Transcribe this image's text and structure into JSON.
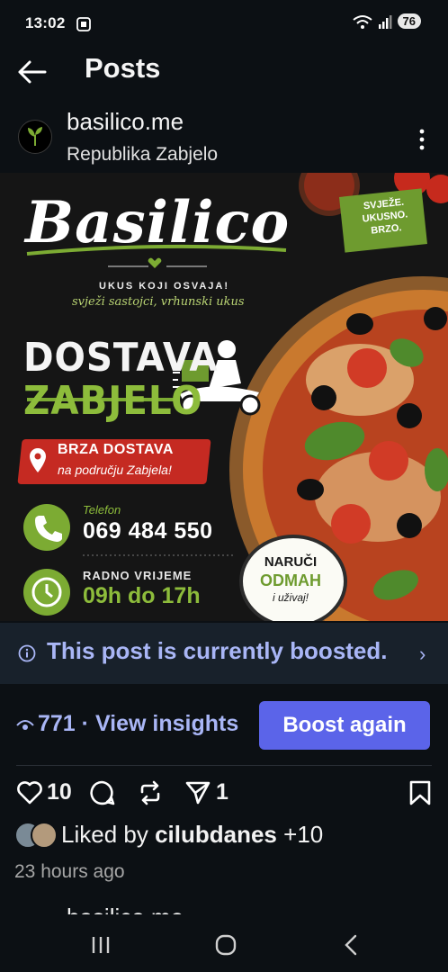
{
  "status_bar": {
    "time": "13:02",
    "battery": "76"
  },
  "header": {
    "title": "Posts"
  },
  "account": {
    "name": "basilico.me",
    "location": "Republika Zabjelo"
  },
  "post_image": {
    "brand": "Basilico",
    "slogan": "UKUS KOJI OSVAJA!",
    "subslogan": "svježi sastojci, vrhunski ukus",
    "headline1": "DOSTAVA",
    "headline2": "ZABJELO",
    "badge": [
      "SVJEŽE.",
      "UKUSNO.",
      "BRZO."
    ],
    "delivery_title": "BRZA DOSTAVA",
    "delivery_sub": "na području Zabjela!",
    "phone_label": "Telefon",
    "phone": "069 484 550",
    "hours_label": "RADNO VRIJEME",
    "hours": "09h do 17h",
    "order_line1": "NARUČI",
    "order_line2": "ODMAH",
    "order_line3": "i uživaj!"
  },
  "boost": {
    "banner": "This post is currently boosted.",
    "views": "771",
    "insights_label": "· View insights",
    "boost_again": "Boost again"
  },
  "actions": {
    "likes": "10",
    "shares": "1"
  },
  "liked_by": {
    "prefix": "Liked by ",
    "user": "cilubdanes",
    "suffix": " +10"
  },
  "time_ago": "23 hours ago",
  "next_post": {
    "account": "basilico.me"
  }
}
